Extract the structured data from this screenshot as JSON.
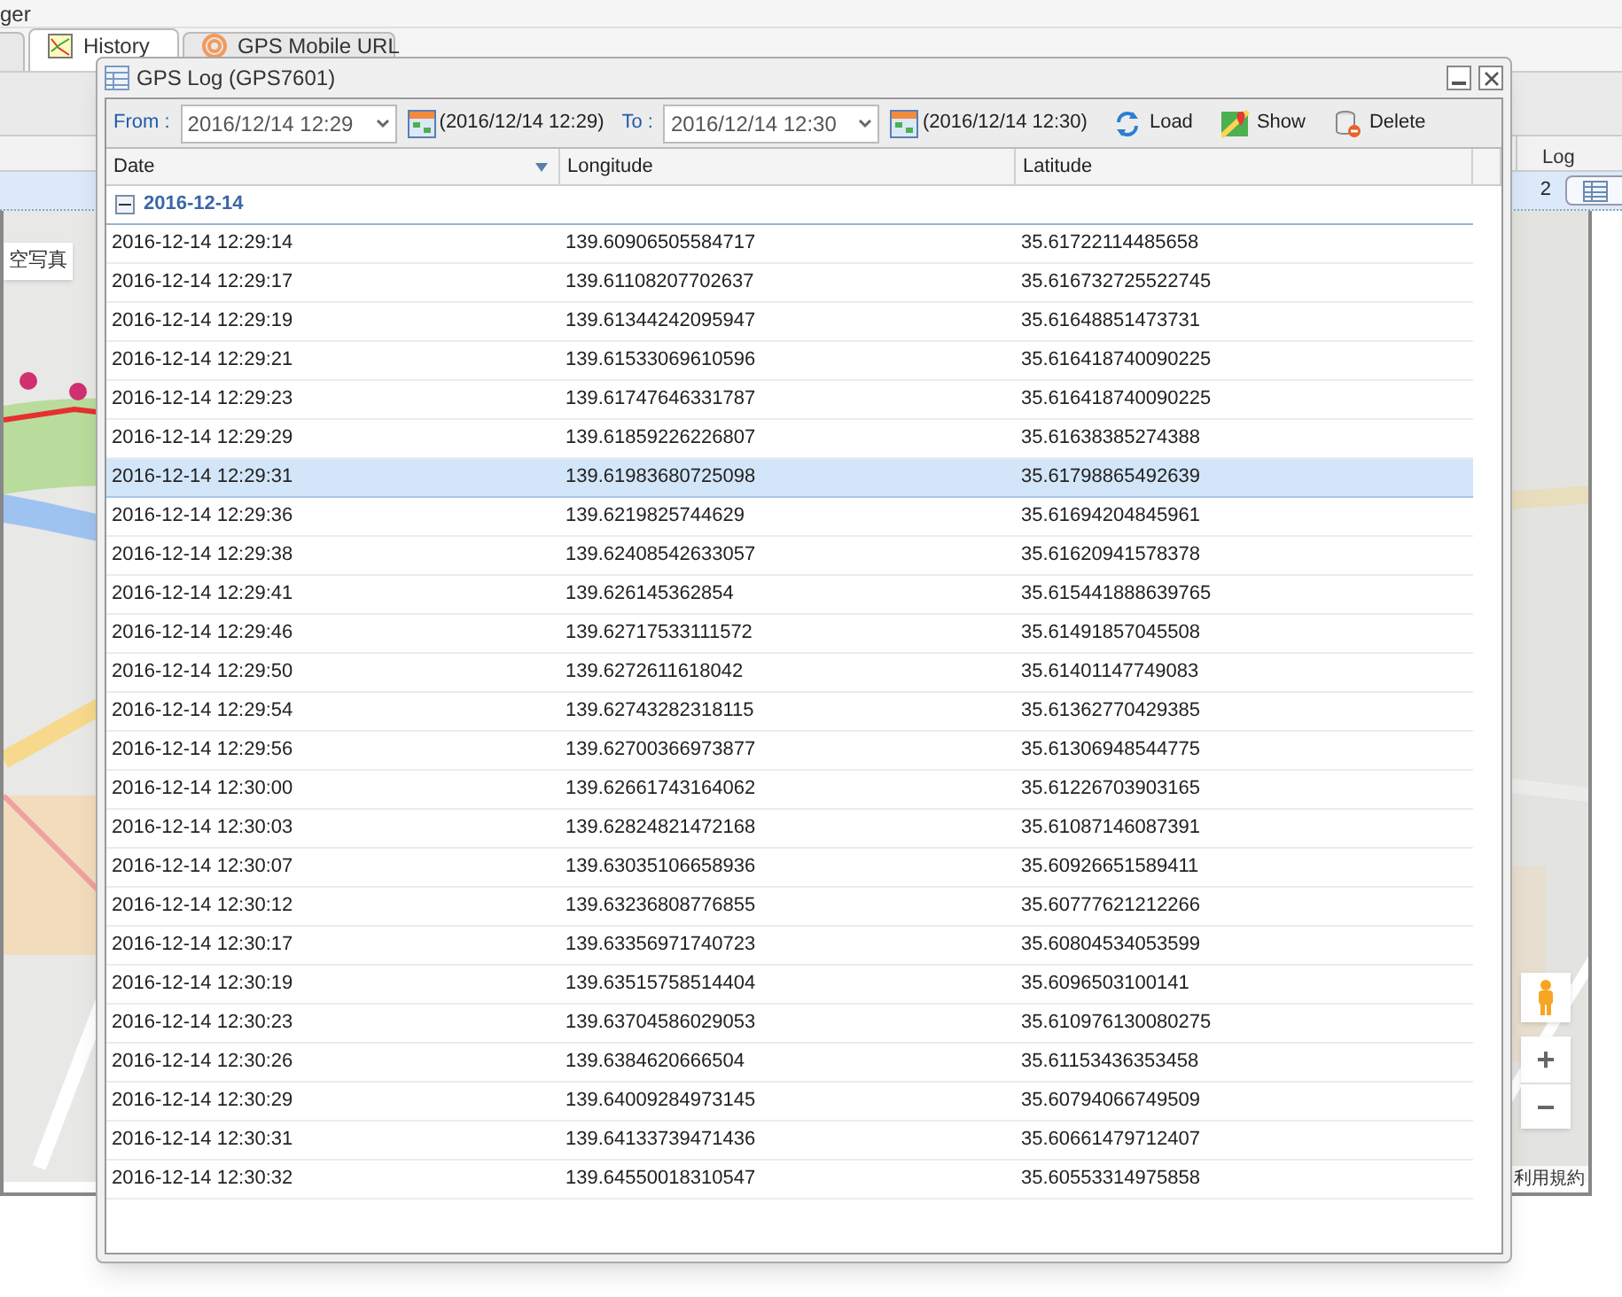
{
  "app_title": "ger",
  "tabs": [
    {
      "selected": false
    },
    {
      "label": "History",
      "selected": true
    },
    {
      "label": "GPS Mobile URL",
      "selected": false
    }
  ],
  "background_grid": {
    "column_label": "Log",
    "row": {
      "cell": "2",
      "selected": true
    }
  },
  "map": {
    "kind": "picture",
    "map_type_button": "空写真",
    "zoom_in": "+",
    "zoom_out": "−",
    "terms": "利用規約"
  },
  "dialog": {
    "title": "GPS Log (GPS7601)",
    "toolbar": {
      "from_label": "From :",
      "from_value": "2016/12/14 12:29",
      "from_note": "(2016/12/14 12:29)",
      "to_label": "To :",
      "to_value": "2016/12/14 12:30",
      "to_note": "(2016/12/14 12:30)",
      "actions": [
        {
          "label": "Load",
          "kind": "load"
        },
        {
          "label": "Show",
          "kind": "show"
        },
        {
          "label": "Delete",
          "kind": "delete"
        }
      ]
    },
    "columns": [
      "Date",
      "Longitude",
      "Latitude"
    ],
    "group": {
      "label": "2016-12-14",
      "expanded": true
    },
    "rows": [
      {
        "date": "2016-12-14 12:29:14",
        "lon": "139.60906505584717",
        "lat": "35.61722114485658",
        "selected": false
      },
      {
        "date": "2016-12-14 12:29:17",
        "lon": "139.61108207702637",
        "lat": "35.616732725522745",
        "selected": false
      },
      {
        "date": "2016-12-14 12:29:19",
        "lon": "139.61344242095947",
        "lat": "35.61648851473731",
        "selected": false
      },
      {
        "date": "2016-12-14 12:29:21",
        "lon": "139.61533069610596",
        "lat": "35.616418740090225",
        "selected": false
      },
      {
        "date": "2016-12-14 12:29:23",
        "lon": "139.61747646331787",
        "lat": "35.616418740090225",
        "selected": false
      },
      {
        "date": "2016-12-14 12:29:29",
        "lon": "139.61859226226807",
        "lat": "35.61638385274388",
        "selected": false
      },
      {
        "date": "2016-12-14 12:29:31",
        "lon": "139.61983680725098",
        "lat": "35.61798865492639",
        "selected": true
      },
      {
        "date": "2016-12-14 12:29:36",
        "lon": "139.6219825744629",
        "lat": "35.61694204845961",
        "selected": false
      },
      {
        "date": "2016-12-14 12:29:38",
        "lon": "139.62408542633057",
        "lat": "35.61620941578378",
        "selected": false
      },
      {
        "date": "2016-12-14 12:29:41",
        "lon": "139.626145362854",
        "lat": "35.615441888639765",
        "selected": false
      },
      {
        "date": "2016-12-14 12:29:46",
        "lon": "139.62717533111572",
        "lat": "35.61491857045508",
        "selected": false
      },
      {
        "date": "2016-12-14 12:29:50",
        "lon": "139.6272611618042",
        "lat": "35.61401147749083",
        "selected": false
      },
      {
        "date": "2016-12-14 12:29:54",
        "lon": "139.62743282318115",
        "lat": "35.61362770429385",
        "selected": false
      },
      {
        "date": "2016-12-14 12:29:56",
        "lon": "139.62700366973877",
        "lat": "35.61306948544775",
        "selected": false
      },
      {
        "date": "2016-12-14 12:30:00",
        "lon": "139.62661743164062",
        "lat": "35.61226703903165",
        "selected": false
      },
      {
        "date": "2016-12-14 12:30:03",
        "lon": "139.62824821472168",
        "lat": "35.61087146087391",
        "selected": false
      },
      {
        "date": "2016-12-14 12:30:07",
        "lon": "139.63035106658936",
        "lat": "35.60926651589411",
        "selected": false
      },
      {
        "date": "2016-12-14 12:30:12",
        "lon": "139.63236808776855",
        "lat": "35.60777621212266",
        "selected": false
      },
      {
        "date": "2016-12-14 12:30:17",
        "lon": "139.63356971740723",
        "lat": "35.60804534053599",
        "selected": false
      },
      {
        "date": "2016-12-14 12:30:19",
        "lon": "139.63515758514404",
        "lat": "35.6096503100141",
        "selected": false
      },
      {
        "date": "2016-12-14 12:30:23",
        "lon": "139.63704586029053",
        "lat": "35.610976130080275",
        "selected": false
      },
      {
        "date": "2016-12-14 12:30:26",
        "lon": "139.6384620666504",
        "lat": "35.61153436353458",
        "selected": false
      },
      {
        "date": "2016-12-14 12:30:29",
        "lon": "139.64009284973145",
        "lat": "35.60794066749509",
        "selected": false
      },
      {
        "date": "2016-12-14 12:30:31",
        "lon": "139.64133739471436",
        "lat": "35.60661479712407",
        "selected": false
      },
      {
        "date": "2016-12-14 12:30:32",
        "lon": "139.64550018310547",
        "lat": "35.60553314975858",
        "selected": false
      }
    ]
  }
}
